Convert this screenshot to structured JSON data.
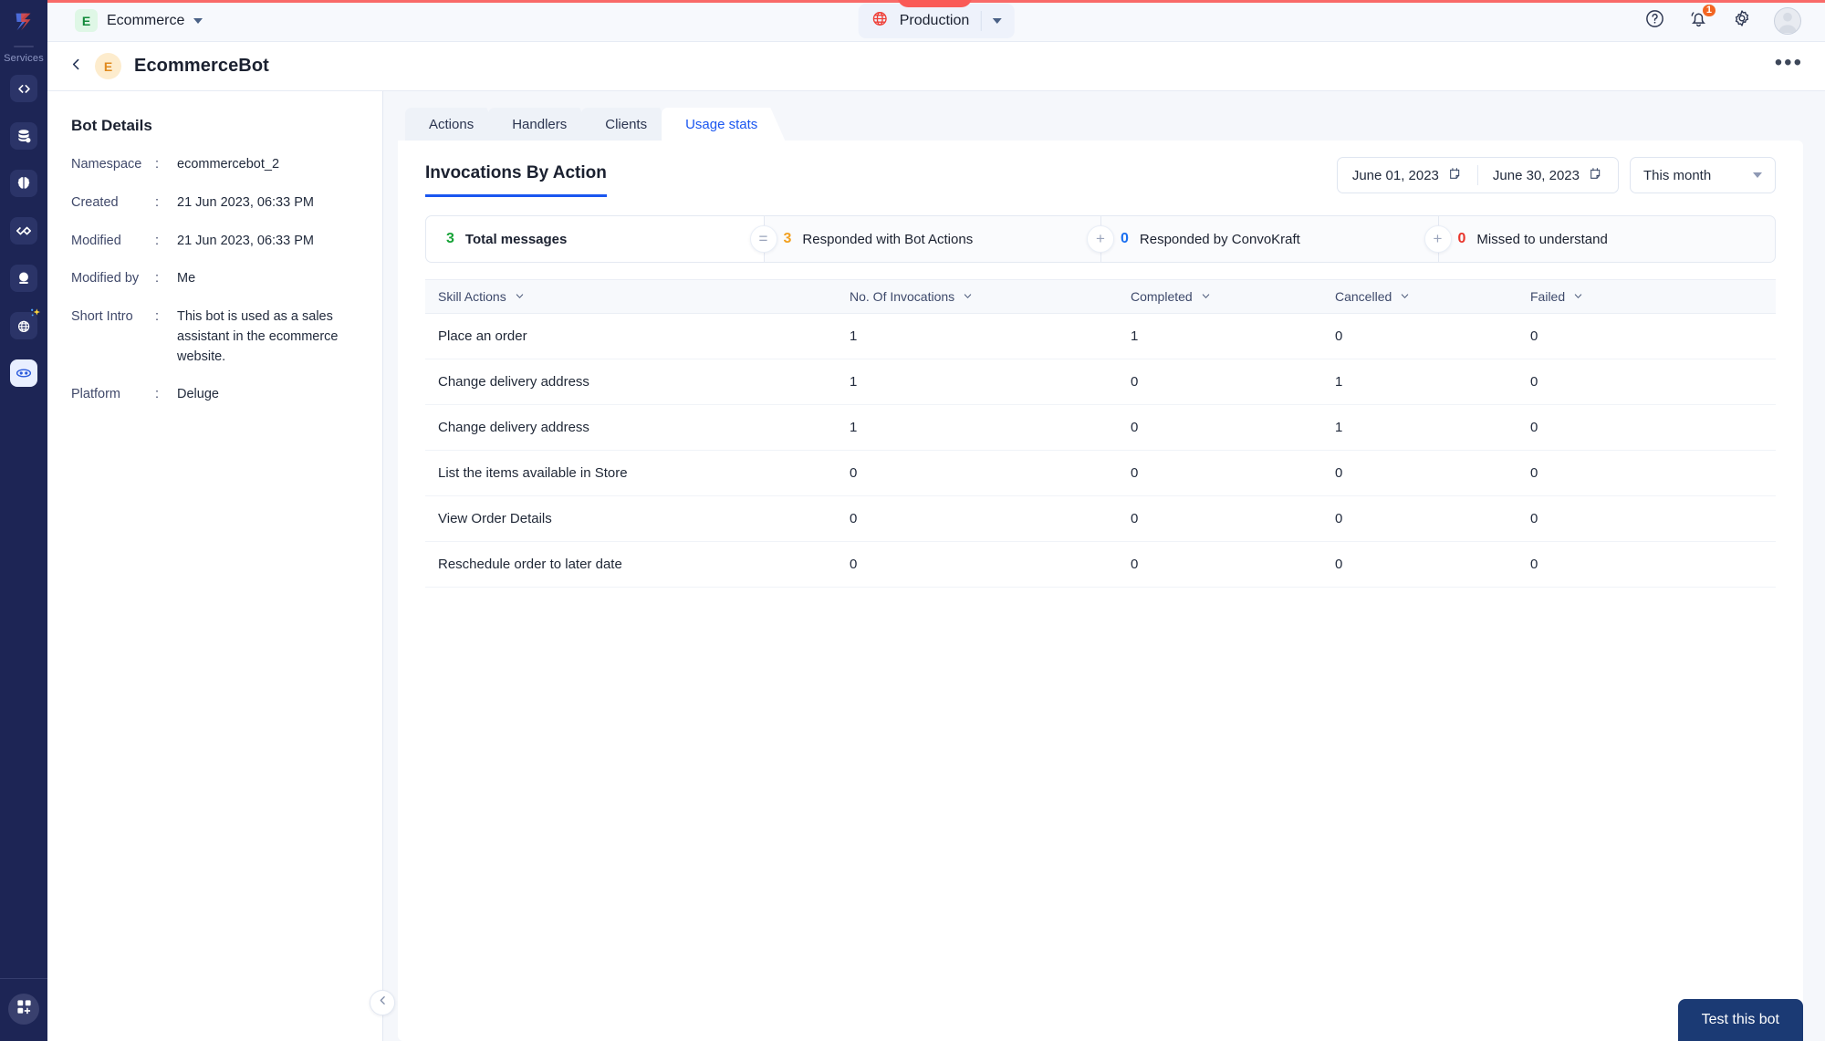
{
  "rail": {
    "services_label": "Services",
    "items": [
      {
        "name": "code-icon",
        "label": "Functions"
      },
      {
        "name": "database-icon",
        "label": "Data Store"
      },
      {
        "name": "brain-icon",
        "label": "AI"
      },
      {
        "name": "infinity-icon",
        "label": "Integrations"
      },
      {
        "name": "crystal-ball-icon",
        "label": "Predictions"
      },
      {
        "name": "globe-sparkle-icon",
        "label": "ConvoKraft"
      },
      {
        "name": "chat-bot-icon",
        "label": "Bots"
      }
    ],
    "bottom_icon": "apps-grid-add-icon"
  },
  "topbar": {
    "workspace_initial": "E",
    "workspace_name": "Ecommerce",
    "environment": "Production",
    "help_icon": "help-circle-icon",
    "notification_icon": "bell-icon",
    "notification_count": "1",
    "settings_icon": "gear-icon",
    "avatar_icon": "user-avatar"
  },
  "pagehead": {
    "back_icon": "chevron-left-icon",
    "bot_initial": "E",
    "bot_title": "EcommerceBot",
    "more_label": "•••"
  },
  "details": {
    "title": "Bot Details",
    "rows": [
      {
        "label": "Namespace",
        "colon": ":",
        "value": "ecommercebot_2"
      },
      {
        "label": "Created",
        "colon": ":",
        "value": "21 Jun 2023, 06:33 PM"
      },
      {
        "label": "Modified",
        "colon": ":",
        "value": "21 Jun 2023, 06:33 PM"
      },
      {
        "label": "Modified by",
        "colon": ":",
        "value": "Me"
      },
      {
        "label": "Short Intro",
        "colon": ":",
        "value": "This bot is used as a sales assistant in the ecommerce website."
      },
      {
        "label": "Platform",
        "colon": ":",
        "value": "Deluge"
      }
    ],
    "collapse_icon": "chevron-left-icon"
  },
  "tabs": [
    {
      "label": "Actions",
      "active": false
    },
    {
      "label": "Handlers",
      "active": false
    },
    {
      "label": "Clients",
      "active": false
    },
    {
      "label": "Usage stats",
      "active": true
    }
  ],
  "panel": {
    "title": "Invocations By Action",
    "date_from": "June 01, 2023",
    "date_to": "June 30, 2023",
    "calendar_icon": "calendar-icon",
    "range_preset": "This month"
  },
  "stats": [
    {
      "value": "3",
      "label": "Total messages",
      "color": "#17a337",
      "operator": "=",
      "operator_name": "equals-badge"
    },
    {
      "value": "3",
      "label": "Responded with Bot Actions",
      "color": "#f2a122",
      "operator": "+",
      "operator_name": "plus-badge"
    },
    {
      "value": "0",
      "label": "Responded by ConvoKraft",
      "color": "#1a6ff0",
      "operator": "+",
      "operator_name": "plus-badge"
    },
    {
      "value": "0",
      "label": "Missed to understand",
      "color": "#e8342b",
      "operator": "",
      "operator_name": ""
    }
  ],
  "table": {
    "columns": [
      "Skill Actions",
      "No. Of Invocations",
      "Completed",
      "Cancelled",
      "Failed"
    ],
    "rows": [
      [
        "Place an order",
        "1",
        "1",
        "0",
        "0"
      ],
      [
        "Change delivery address",
        "1",
        "0",
        "1",
        "0"
      ],
      [
        "Change delivery address",
        "1",
        "0",
        "1",
        "0"
      ],
      [
        "List the items available in Store",
        "0",
        "0",
        "0",
        "0"
      ],
      [
        "View Order Details",
        "0",
        "0",
        "0",
        "0"
      ],
      [
        "Reschedule order to later date",
        "0",
        "0",
        "0",
        "0"
      ]
    ]
  },
  "footer": {
    "test_button": "Test this bot"
  },
  "colors": {
    "rail_bg": "#1d2555",
    "accent_blue": "#1a56f0",
    "top_strip": "#f96a68",
    "test_button_bg": "#1b3a74"
  }
}
